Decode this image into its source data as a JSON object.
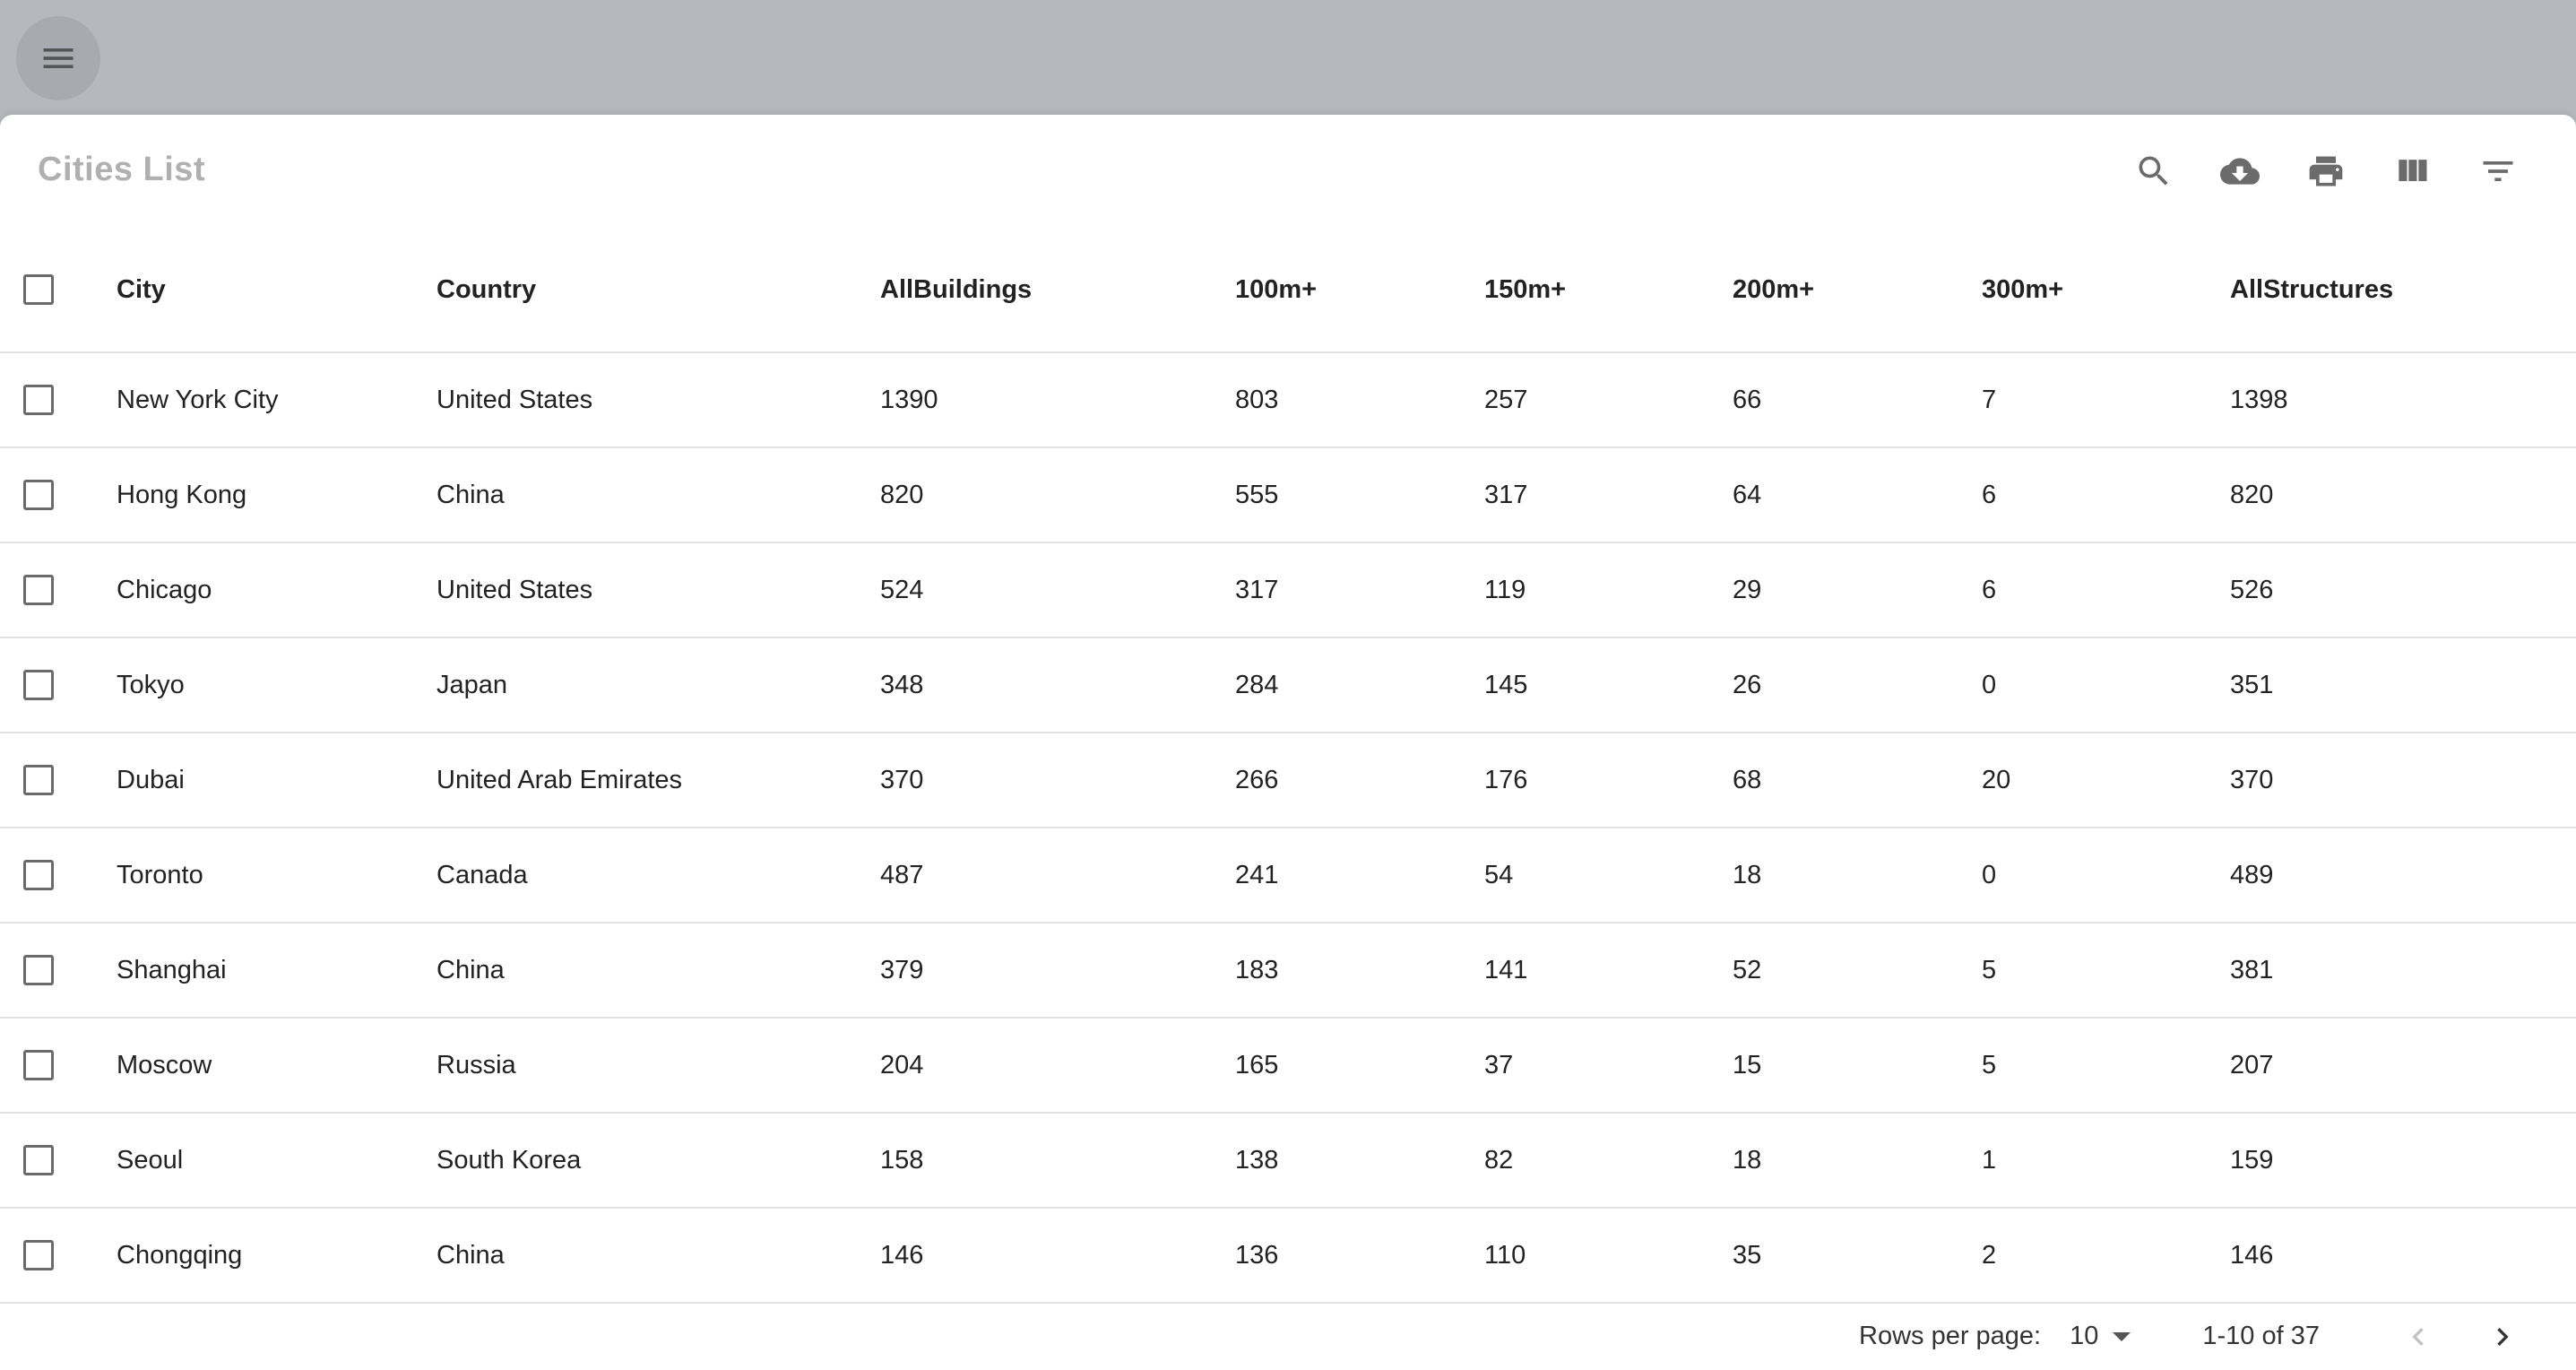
{
  "appbar": {
    "menu_icon": "menu-icon"
  },
  "toolbar": {
    "title": "Cities List",
    "icons": [
      "search-icon",
      "cloud-download-icon",
      "print-icon",
      "view-column-icon",
      "filter-list-icon"
    ]
  },
  "table": {
    "columns": [
      "City",
      "Country",
      "AllBuildings",
      "100m+",
      "150m+",
      "200m+",
      "300m+",
      "AllStructures"
    ],
    "rows": [
      [
        "New York City",
        "United States",
        "1390",
        "803",
        "257",
        "66",
        "7",
        "1398"
      ],
      [
        "Hong Kong",
        "China",
        "820",
        "555",
        "317",
        "64",
        "6",
        "820"
      ],
      [
        "Chicago",
        "United States",
        "524",
        "317",
        "119",
        "29",
        "6",
        "526"
      ],
      [
        "Tokyo",
        "Japan",
        "348",
        "284",
        "145",
        "26",
        "0",
        "351"
      ],
      [
        "Dubai",
        "United Arab Emirates",
        "370",
        "266",
        "176",
        "68",
        "20",
        "370"
      ],
      [
        "Toronto",
        "Canada",
        "487",
        "241",
        "54",
        "18",
        "0",
        "489"
      ],
      [
        "Shanghai",
        "China",
        "379",
        "183",
        "141",
        "52",
        "5",
        "381"
      ],
      [
        "Moscow",
        "Russia",
        "204",
        "165",
        "37",
        "15",
        "5",
        "207"
      ],
      [
        "Seoul",
        "South Korea",
        "158",
        "138",
        "82",
        "18",
        "1",
        "159"
      ],
      [
        "Chongqing",
        "China",
        "146",
        "136",
        "110",
        "35",
        "2",
        "146"
      ]
    ]
  },
  "pagination": {
    "rows_per_page_label": "Rows per page:",
    "rows_per_page_value": "10",
    "range_label": "1-10 of 37"
  }
}
